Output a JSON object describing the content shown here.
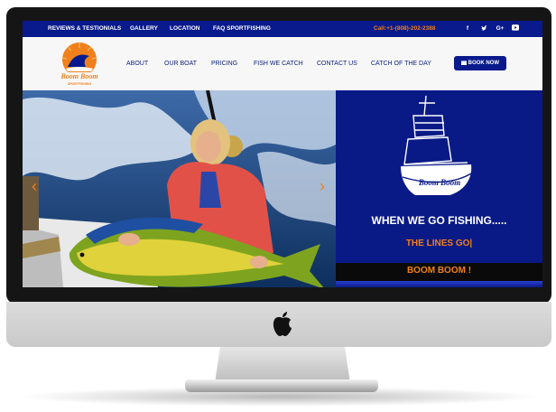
{
  "topbar": {
    "links": [
      "REVIEWS & TESTIONIALS",
      "GALLERY",
      "LOCATION",
      "FAQ SPORTFISHING"
    ],
    "phone": "Call:+1-(808)-202-2388",
    "social": [
      {
        "name": "facebook-icon",
        "glyph": "f"
      },
      {
        "name": "twitter-icon",
        "glyph": "ἥ"
      },
      {
        "name": "google-plus-icon",
        "glyph": "G+"
      },
      {
        "name": "youtube-icon",
        "glyph": "▶"
      }
    ]
  },
  "nav": {
    "logo_text": "Boom Boom",
    "logo_subtext": "SPORTFISHING",
    "links": [
      "ABOUT",
      "OUR BOAT",
      "PRICING",
      "FISH WE CATCH",
      "CONTACT US",
      "CATCH OF THE DAY"
    ],
    "book_label": "BOOK NOW"
  },
  "hero": {
    "headline": "WHEN WE GO FISHING.....",
    "typed": "THE LINES GO|",
    "stripe": "BOOM BOOM !",
    "boat_name": "Boom Boom"
  },
  "colors": {
    "navy": "#081a8c",
    "orange": "#f0801c"
  }
}
